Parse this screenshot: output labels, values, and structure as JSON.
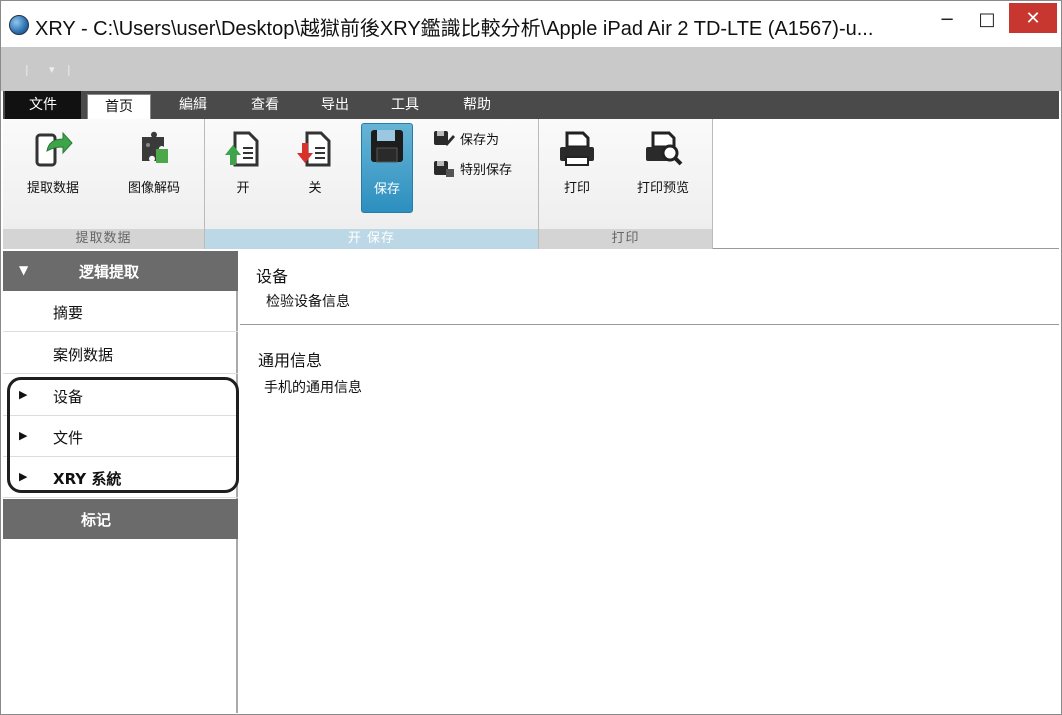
{
  "window": {
    "title": "XRY - C:\\Users\\user\\Desktop\\越獄前後XRY鑑識比較分析\\Apple iPad Air 2 TD-LTE (A1567)-u...",
    "minimize_glyph": "−",
    "maximize_glyph": "□",
    "close_glyph": "✕"
  },
  "menu": {
    "tabs": [
      "文件",
      "首页",
      "編緝",
      "查看",
      "导出",
      "工具",
      "帮助"
    ]
  },
  "ribbon": {
    "groups": [
      {
        "label": "提取数据",
        "buttons": [
          "提取数据",
          "图像解码"
        ]
      },
      {
        "label": "开 保存",
        "buttons": [
          "开",
          "关",
          "保存"
        ],
        "small_buttons": [
          "保存为",
          "特别保存"
        ]
      },
      {
        "label": "打印",
        "buttons": [
          "打印",
          "打印预览"
        ]
      }
    ]
  },
  "left_panel": {
    "header": "逻辑提取",
    "items": [
      "摘要",
      "案例数据",
      "设备",
      "文件",
      "XRY 系統"
    ],
    "bookmark": "标记"
  },
  "main": {
    "section1": {
      "title": "设备",
      "subtitle": "检验设备信息"
    },
    "section2": {
      "title": "通用信息",
      "subtitle": "手机的通用信息"
    }
  },
  "colors": {
    "accent_blue": "#2c8fbf",
    "panel_gray": "#6b6b6b",
    "menu_dark": "#4a4a4a",
    "close_red": "#c7372f"
  }
}
